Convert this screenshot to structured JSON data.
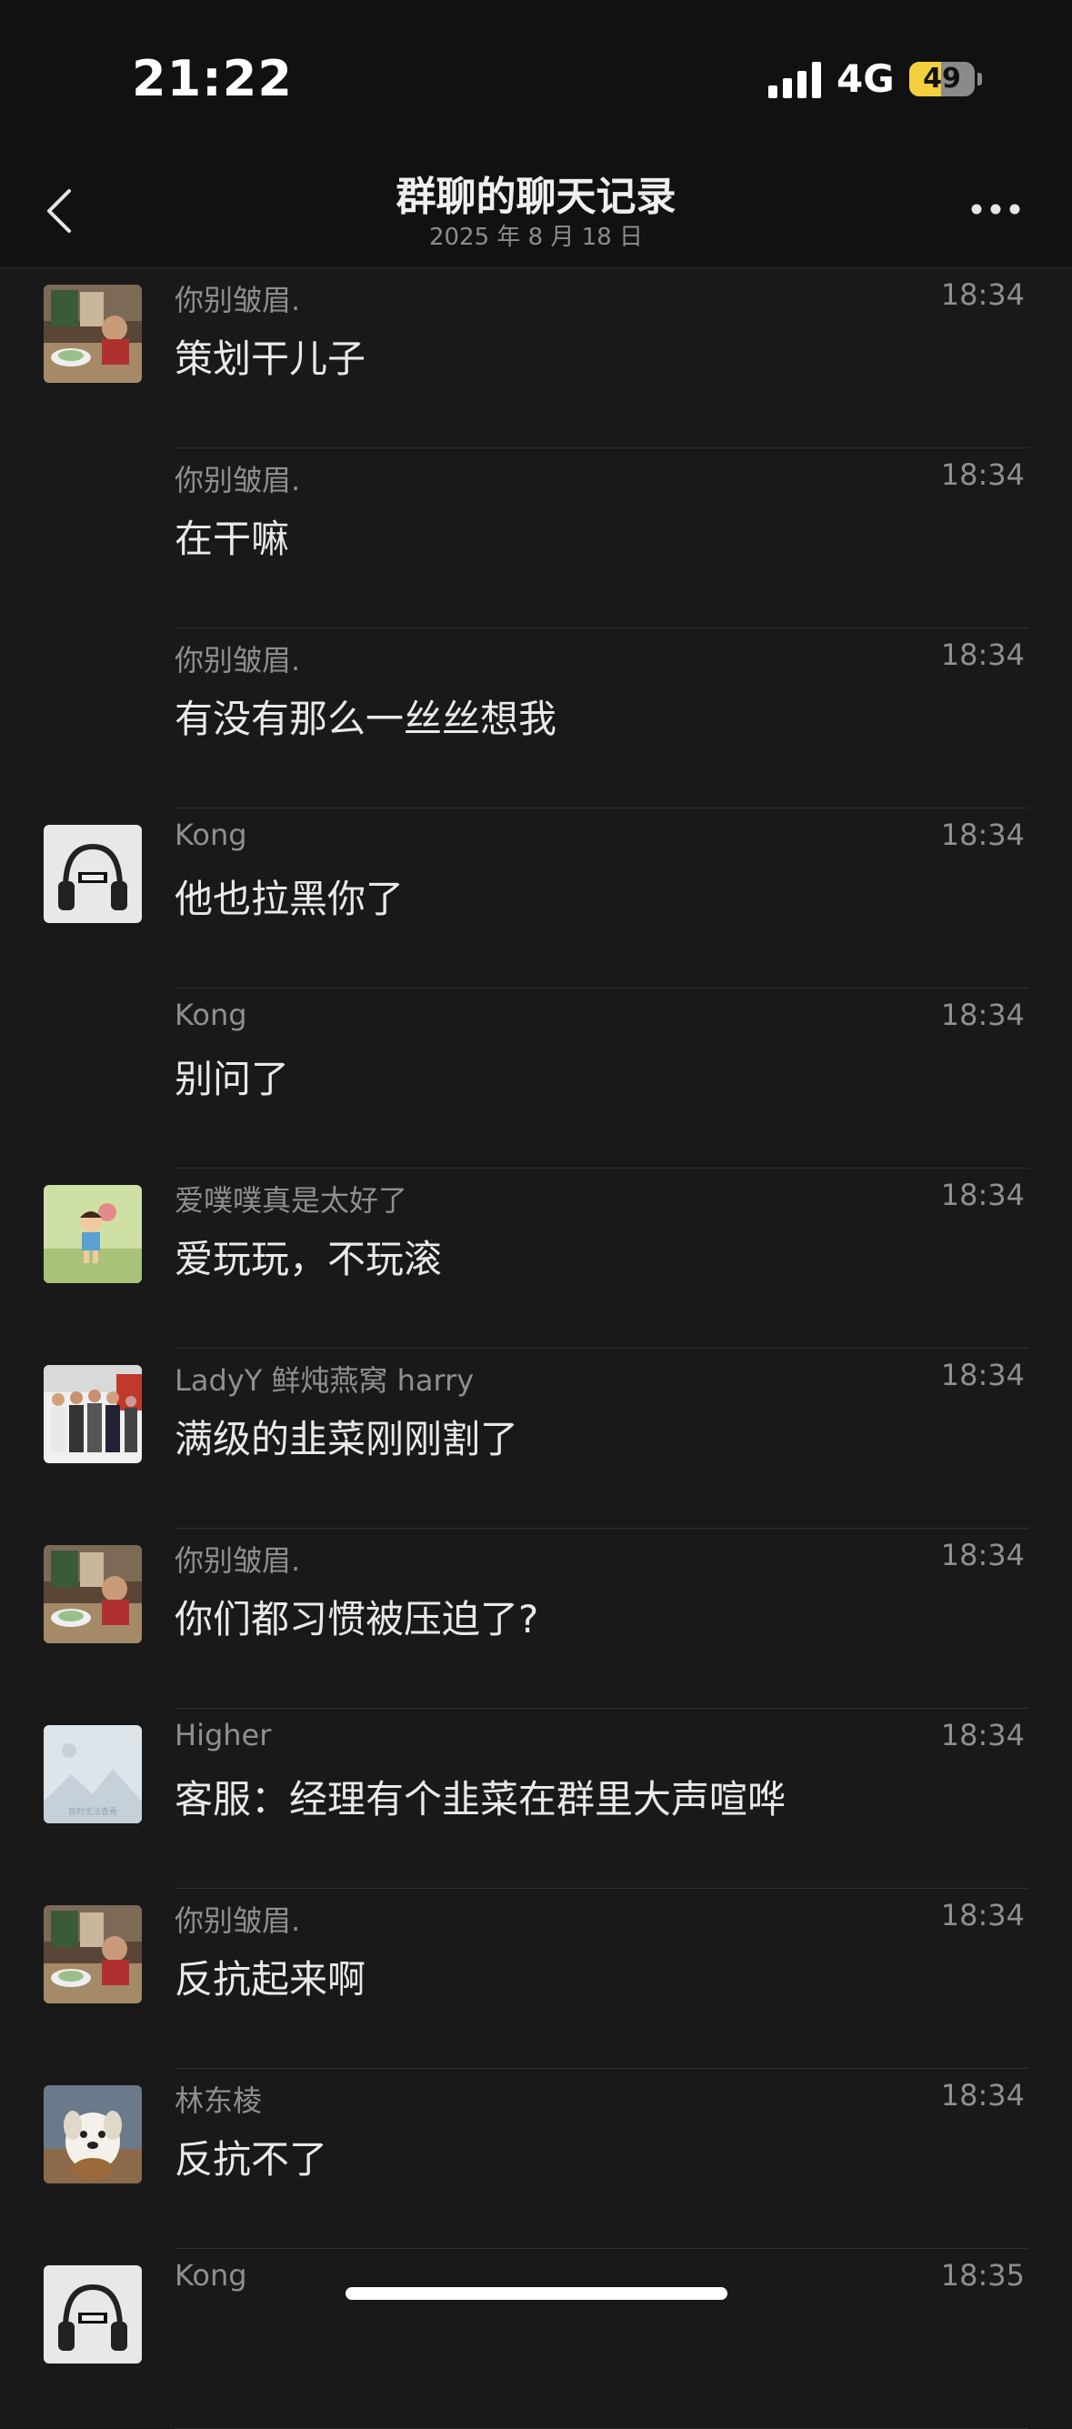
{
  "status": {
    "time": "21:22",
    "network": "4G",
    "battery": "49",
    "battery_level": 0.49
  },
  "header": {
    "title": "群聊的聊天记录",
    "date": "2025 年 8 月 18 日"
  },
  "messages": [
    {
      "name": "你别皱眉.",
      "time": "18:34",
      "text": "策划干儿子",
      "avatar": "avatar-dinner-table"
    },
    {
      "name": "你别皱眉.",
      "time": "18:34",
      "text": "在干嘛",
      "avatar": ""
    },
    {
      "name": "你别皱眉.",
      "time": "18:34",
      "text": "有没有那么一丝丝想我",
      "avatar": ""
    },
    {
      "name": "Kong",
      "time": "18:34",
      "text": "他也拉黑你了",
      "avatar": "avatar-headphones"
    },
    {
      "name": "Kong",
      "time": "18:34",
      "text": "别问了",
      "avatar": ""
    },
    {
      "name": "爱噗噗真是太好了",
      "time": "18:34",
      "text": "爱玩玩，不玩滚",
      "avatar": "avatar-cartoon-child"
    },
    {
      "name": "LadyY 鲜炖燕窝 harry",
      "time": "18:34",
      "text": "满级的韭菜刚刚割了",
      "avatar": "avatar-group-photo"
    },
    {
      "name": "你别皱眉.",
      "time": "18:34",
      "text": "你们都习惯被压迫了?",
      "avatar": "avatar-dinner-table"
    },
    {
      "name": "Higher",
      "time": "18:34",
      "text": "客服：经理有个韭菜在群里大声喧哗",
      "avatar": "avatar-placeholder-image"
    },
    {
      "name": "你别皱眉.",
      "time": "18:34",
      "text": "反抗起来啊",
      "avatar": "avatar-dinner-table"
    },
    {
      "name": "林东棱",
      "time": "18:34",
      "text": "反抗不了",
      "avatar": "avatar-puppy"
    },
    {
      "name": "Kong",
      "time": "18:35",
      "text": "",
      "avatar": "avatar-headphones"
    }
  ],
  "avatar_placeholder_text": "暂时无法查看"
}
